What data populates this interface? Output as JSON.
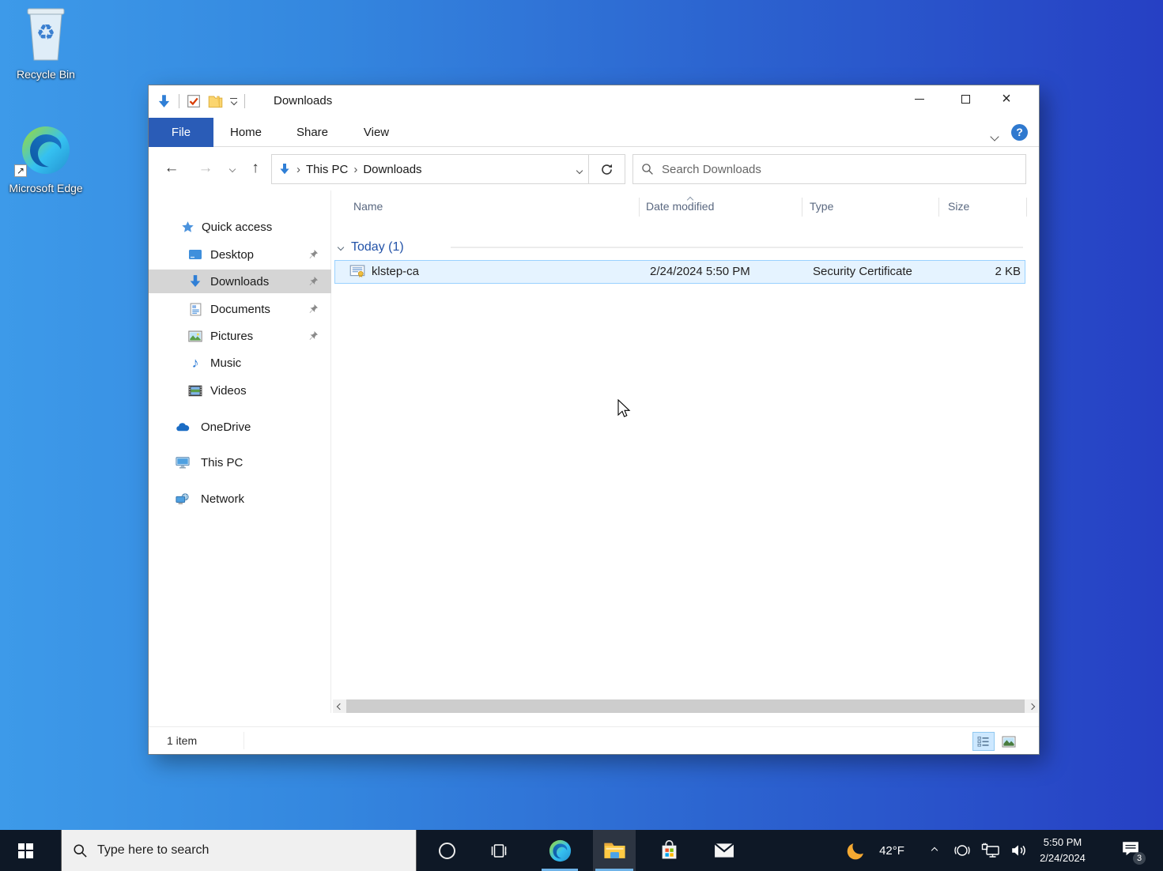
{
  "colors": {
    "desktop_gradient_left": "#3d9ae9",
    "desktop_gradient_right": "#2640c4",
    "taskbar_bg": "#0e1826",
    "file_tab_blue": "#2a5cb7",
    "selection_fill": "#e5f3ff",
    "selection_border": "#99d1ff"
  },
  "glyphs": {
    "back": "←",
    "forward": "→",
    "up": "↑",
    "breadcrumb_sep": "›",
    "music": "♪",
    "recycle": "♻",
    "help": "?",
    "close": "×",
    "shortcut_arrow": "↗"
  },
  "desktop": {
    "icons": [
      {
        "label": "Recycle Bin"
      },
      {
        "label": "Microsoft Edge"
      }
    ]
  },
  "window": {
    "title": "Downloads",
    "tabs": {
      "file": "File",
      "home": "Home",
      "share": "Share",
      "view": "View"
    },
    "address": {
      "root": "This PC",
      "current": "Downloads"
    },
    "search_placeholder": "Search Downloads",
    "columns": {
      "name": "Name",
      "date_modified": "Date modified",
      "type": "Type",
      "size": "Size"
    },
    "group_label": "Today (1)",
    "files": [
      {
        "name": "klstep-ca",
        "date_modified": "2/24/2024 5:50 PM",
        "type": "Security Certificate",
        "size": "2 KB"
      }
    ],
    "sidebar": {
      "quick_access": "Quick access",
      "items": {
        "desktop": "Desktop",
        "downloads": "Downloads",
        "documents": "Documents",
        "pictures": "Pictures",
        "music": "Music",
        "videos": "Videos",
        "onedrive": "OneDrive",
        "this_pc": "This PC",
        "network": "Network"
      }
    },
    "status": {
      "item_count": "1 item"
    }
  },
  "taskbar": {
    "search_placeholder": "Type here to search",
    "weather": {
      "temp": "42°F"
    },
    "clock": {
      "time": "5:50 PM",
      "date": "2/24/2024"
    },
    "notifications": {
      "badge": "3"
    }
  }
}
